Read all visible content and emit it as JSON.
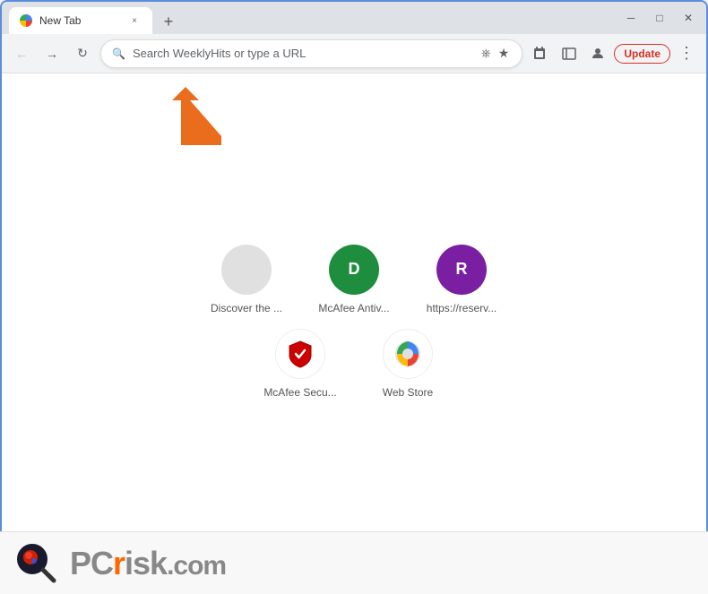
{
  "window": {
    "title": "New Tab",
    "tab_label": "New Tab",
    "close_label": "×",
    "new_tab_label": "+",
    "minimize_label": "─",
    "maximize_label": "□",
    "close_window_label": "✕"
  },
  "toolbar": {
    "back_title": "Back",
    "forward_title": "Forward",
    "reload_title": "Reload",
    "address_placeholder": "Search WeeklyHits or type a URL",
    "share_title": "Share",
    "bookmark_title": "Bookmark",
    "extensions_title": "Extensions",
    "sidebar_title": "Sidebar",
    "profile_title": "Profile",
    "update_label": "Update",
    "more_title": "More"
  },
  "shortcuts": {
    "row1": [
      {
        "label": "Discover the ...",
        "icon_type": "gray",
        "icon_text": ""
      },
      {
        "label": "McAfee Antiv...",
        "icon_type": "green",
        "icon_text": "D"
      },
      {
        "label": "https://reserv...",
        "icon_type": "purple",
        "icon_text": "R"
      }
    ],
    "row2": [
      {
        "label": "McAfee Secu...",
        "icon_type": "mcafee",
        "icon_text": "shield"
      },
      {
        "label": "Web Store",
        "icon_type": "webstore",
        "icon_text": ""
      }
    ]
  },
  "arrow": {
    "color": "#e85d04",
    "label": "arrow-up-left"
  },
  "watermark": {
    "brand_pc": "PC",
    "brand_risk": "risk",
    "brand_com": ".com",
    "brand_orange": "r"
  },
  "colors": {
    "accent_blue": "#5b8dd9",
    "tab_bg": "#ffffff",
    "toolbar_bg": "#f1f3f4",
    "update_red": "#d93025",
    "arrow_orange": "#e85d04"
  }
}
